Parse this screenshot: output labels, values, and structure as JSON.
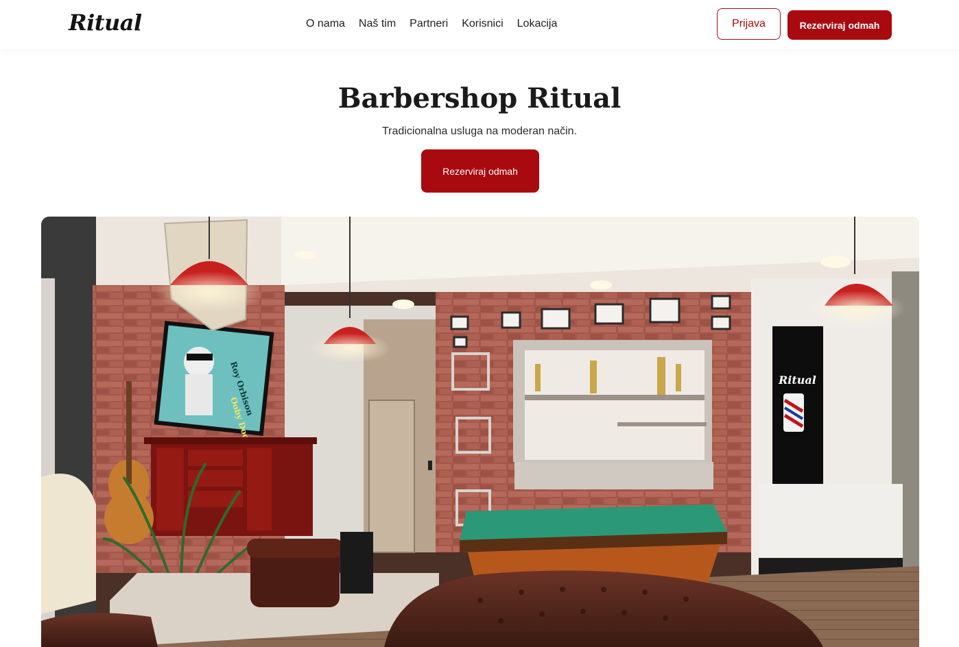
{
  "brand": {
    "logo_text": "Ritual"
  },
  "nav": {
    "items": [
      {
        "label": "O nama"
      },
      {
        "label": "Naš tim"
      },
      {
        "label": "Partneri"
      },
      {
        "label": "Korisnici"
      },
      {
        "label": "Lokacija"
      }
    ]
  },
  "header": {
    "login_label": "Prijava",
    "book_label": "Rezerviraj odmah"
  },
  "hero": {
    "title": "Barbershop Ritual",
    "subtitle": "Tradicionalna usluga na moderan način.",
    "cta_label": "Rezerviraj odmah"
  },
  "photo": {
    "tv_text_1": "Roy Orbison",
    "tv_text_2": "Ooby Dooby",
    "wall_logo": "Ritual"
  },
  "colors": {
    "accent": "#a80a10",
    "text": "#1e1e1e",
    "background": "#ffffff"
  }
}
